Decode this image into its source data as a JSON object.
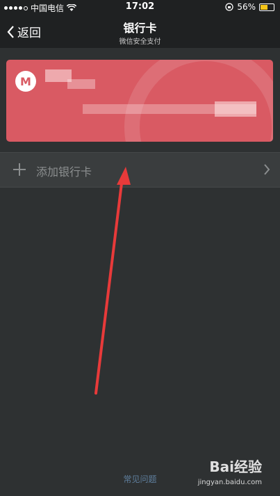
{
  "status_bar": {
    "carrier": "中国电信",
    "time": "17:02",
    "battery_percent": 56,
    "battery_text": "56%"
  },
  "nav": {
    "back_label": "返回",
    "title": "银行卡",
    "subtitle": "微信安全支付"
  },
  "card": {
    "color": "#d95a63"
  },
  "add_card": {
    "label": "添加银行卡"
  },
  "footer": {
    "faq": "常见问题"
  },
  "watermark": {
    "brand": "Bai经验",
    "url": "jingyan.baidu.com"
  }
}
